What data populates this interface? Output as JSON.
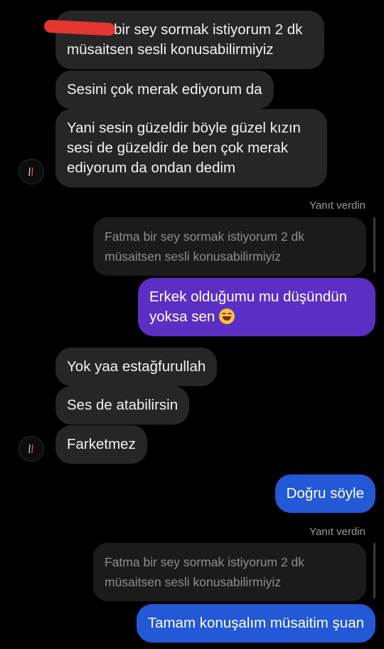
{
  "messages": {
    "m1": "bir sey sormak istiyorum 2 dk müsaitsen sesli konusabilirmiyiz",
    "m2": "Sesini çok merak ediyorum da",
    "m3": "Yani sesin güzeldir böyle güzel kızın sesi de güzeldir de ben çok merak ediyorum da ondan dedim",
    "reply_label_1": "Yanıt verdin",
    "quoted_1": "Fatma bir sey sormak istiyorum 2 dk müsaitsen sesli konusabilirmiyiz",
    "m4": "Erkek olduğumu mu düşündün yoksa sen",
    "m5": "Yok yaa estağfurullah",
    "m6": "Ses de atabilirsin",
    "m7": "Farketmez",
    "m8": "Doğru söyle",
    "reply_label_2": "Yanıt verdin",
    "quoted_2": "Fatma bir sey sormak istiyorum 2 dk müsaitsen sesli konusabilirmiyiz",
    "m9": "Tamam konuşalım müsaitim şuan"
  },
  "icons": {
    "avatar": "profile-avatar",
    "emoji": "face-with-tears-of-joy"
  },
  "colors": {
    "background": "#000000",
    "incoming_bubble": "#262626",
    "outgoing_purple": "#5b2fc4",
    "outgoing_blue": "#2358d6"
  }
}
